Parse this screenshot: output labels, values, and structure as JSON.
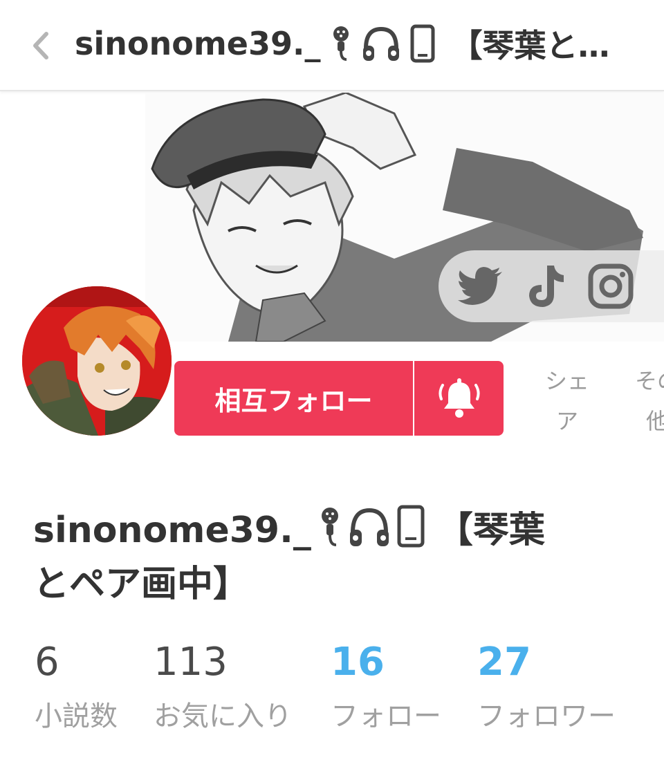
{
  "header": {
    "back_icon": "chevron-left-icon",
    "title_name": "sinonome39._",
    "title_icons": [
      "microphone-icon",
      "headphones-icon",
      "smartphone-icon"
    ],
    "title_tail": "【琴葉と…"
  },
  "banner": {
    "social_icons": [
      "twitter-icon",
      "tiktok-icon",
      "instagram-icon"
    ]
  },
  "actions": {
    "follow_label": "相互フォロー",
    "bell_icon": "bell-ringing-icon",
    "share_label_line1": "シェ",
    "share_label_line2": "ア",
    "other_label_line1": "その",
    "other_label_line2": "他"
  },
  "profile": {
    "name_line1": "sinonome39._",
    "name_icons": [
      "microphone-icon",
      "headphones-icon",
      "smartphone-icon"
    ],
    "name_line1_tail": "【琴葉",
    "name_line2": "とペア画中】"
  },
  "stats": [
    {
      "value": "6",
      "label": "小説数",
      "highlight": false
    },
    {
      "value": "113",
      "label": "お気に入り",
      "highlight": false
    },
    {
      "value": "16",
      "label": "フォロー",
      "highlight": true
    },
    {
      "value": "27",
      "label": "フォロワー",
      "highlight": true
    }
  ],
  "colors": {
    "accent": "#ef3a57",
    "link_blue": "#4ab0ec",
    "text_dark": "#333333",
    "text_muted": "#a0a0a0"
  }
}
